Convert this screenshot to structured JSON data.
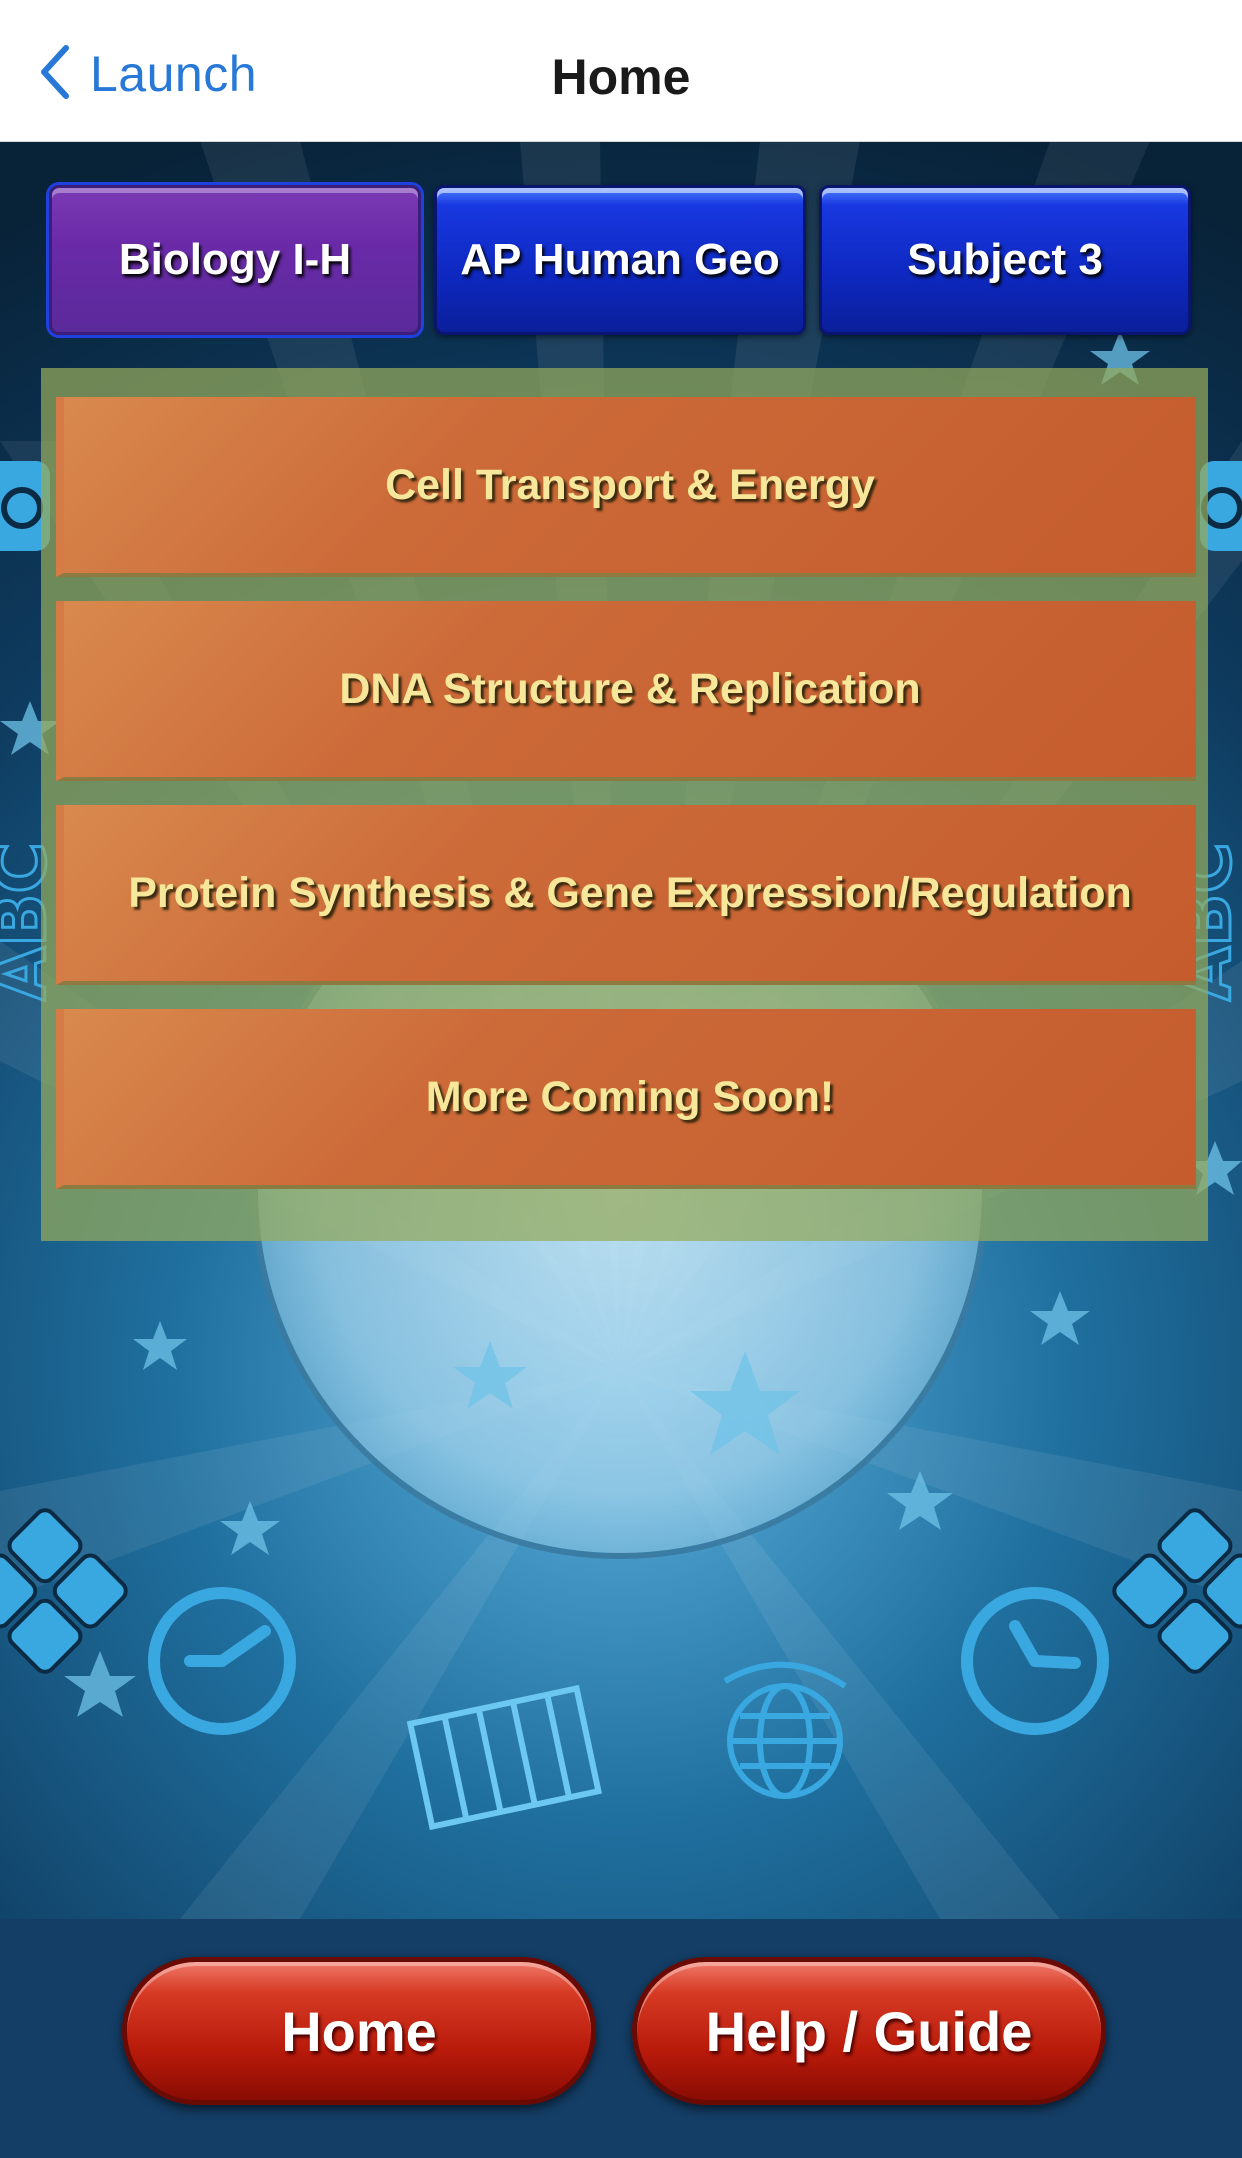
{
  "navbar": {
    "back_label": "Launch",
    "back_icon": "chevron-left-icon",
    "title": "Home"
  },
  "subject_tabs": [
    {
      "label": "Biology I-H",
      "selected": true
    },
    {
      "label": "AP Human Geo",
      "selected": false
    },
    {
      "label": "Subject 3",
      "selected": false
    }
  ],
  "topics": [
    {
      "label": "Cell Transport & Energy"
    },
    {
      "label": "DNA Structure & Replication"
    },
    {
      "label": "Protein Synthesis & Gene Expression/Regulation"
    },
    {
      "label": "More Coming Soon!"
    }
  ],
  "bottom_buttons": {
    "home_label": "Home",
    "help_label": "Help / Guide"
  },
  "background_decor": {
    "side_text": "ABC",
    "icons": [
      "star-icon",
      "calculator-icon",
      "clock-icon",
      "globe-icon",
      "abacus-icon",
      "camera-icon"
    ]
  },
  "colors": {
    "nav_link": "#2878d8",
    "tab_blue": "#0e28c0",
    "tab_selected_purple": "#6a2aa8",
    "topic_orange": "#c55c2e",
    "topic_text": "#f6e79a",
    "panel_green": "#96aa5a",
    "pill_red": "#b81a0a",
    "background_dark": "#0b2a44"
  }
}
